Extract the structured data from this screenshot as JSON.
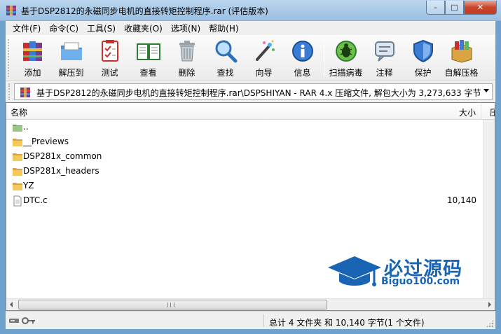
{
  "window": {
    "title": "基于DSP2812的永磁同步电机的直接转矩控制程序.rar (评估版本)",
    "minimize": "–",
    "maximize": "□",
    "close": "✕"
  },
  "menu": [
    "文件(F)",
    "命令(C)",
    "工具(S)",
    "收藏夹(O)",
    "选项(N)",
    "帮助(H)"
  ],
  "toolbar": {
    "add": "添加",
    "extract": "解压到",
    "test": "测试",
    "view": "查看",
    "delete": "删除",
    "find": "查找",
    "wizard": "向导",
    "info": "信息",
    "virus": "扫描病毒",
    "comment": "注释",
    "protect": "保护",
    "sfx": "自解压格"
  },
  "address": {
    "path": "基于DSP2812的永磁同步电机的直接转矩控制程序.rar\\DSPSHIYAN - RAR 4.x 压缩文件, 解包大小为 3,273,633 字节"
  },
  "columns": {
    "name": "名称",
    "size": "大小",
    "more": "压"
  },
  "files": [
    {
      "name": "..",
      "size": "",
      "type": "up"
    },
    {
      "name": "__Previews",
      "size": "",
      "type": "folder"
    },
    {
      "name": "DSP281x_common",
      "size": "",
      "type": "folder"
    },
    {
      "name": "DSP281x_headers",
      "size": "",
      "type": "folder"
    },
    {
      "name": "YZ",
      "size": "",
      "type": "folder"
    },
    {
      "name": "DTC.c",
      "size": "10,140",
      "type": "file"
    }
  ],
  "watermark": {
    "title": "必过源码",
    "url": "Biguo100.com"
  },
  "status": {
    "text": "总计 4 文件夹 和 10,140 字节(1 个文件)"
  },
  "colors": {
    "folder": "#e8b83a",
    "accent": "#1a64b4",
    "titlebar": "#a6c7e6"
  }
}
